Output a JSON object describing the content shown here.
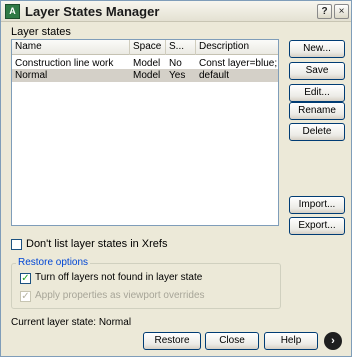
{
  "window": {
    "title": "Layer States Manager",
    "app_icon_text": "A",
    "help_glyph": "?",
    "close_glyph": "×"
  },
  "layer_states_label": "Layer states",
  "list": {
    "columns": [
      "Name",
      "Space",
      "S...",
      "Description"
    ],
    "rows": [
      {
        "name": "Construction line work",
        "space": "Model",
        "save": "No",
        "description": "Const layer=blue; othe..."
      },
      {
        "name": "Normal",
        "space": "Model",
        "save": "Yes",
        "description": "default"
      }
    ],
    "selected_index": 1
  },
  "side_buttons": {
    "new": "New...",
    "save": "Save",
    "edit": "Edit...",
    "rename": "Rename",
    "delete": "Delete",
    "import": "Import...",
    "export": "Export..."
  },
  "dont_list_xrefs": {
    "label": "Don't list layer states in Xrefs",
    "checked": false
  },
  "restore_options": {
    "title": "Restore options",
    "turn_off": {
      "label": "Turn off layers not found in layer state",
      "checked": true
    },
    "apply_viewport": {
      "label": "Apply properties as viewport overrides",
      "checked": true,
      "disabled": true
    }
  },
  "current_state": "Current layer state: Normal",
  "bottom_buttons": {
    "restore": "Restore",
    "close": "Close",
    "help": "Help",
    "more_glyph": "›"
  },
  "colors": {
    "accent": "#0046d5",
    "selected_row": "#d4d0c8",
    "dialog_bg": "#ece9d8"
  }
}
